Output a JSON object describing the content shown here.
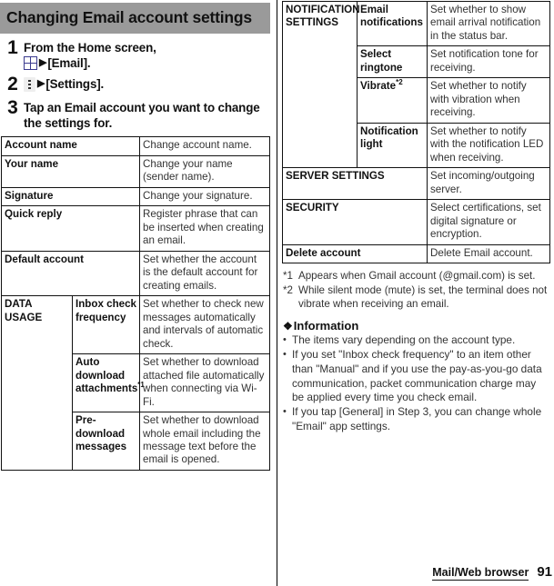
{
  "header": {
    "title": "Changing Email account settings",
    "banner_color": "#9a9a9a"
  },
  "steps": [
    {
      "number": "1",
      "line1": "From the Home screen,",
      "icon": "app-grid-icon",
      "arrow": "▶",
      "target": "[Email]."
    },
    {
      "number": "2",
      "line1": "",
      "icon": "overflow-menu-icon",
      "arrow": "▶",
      "target": "[Settings]."
    },
    {
      "number": "3",
      "line1": "Tap an Email account you want to change the settings for.",
      "icon": "",
      "arrow": "",
      "target": ""
    }
  ],
  "left_table": {
    "rows": [
      {
        "group": "",
        "key": "Account name",
        "desc": "Change account name."
      },
      {
        "group": "",
        "key": "Your name",
        "desc": "Change your name (sender name)."
      },
      {
        "group": "",
        "key": "Signature",
        "desc": "Change your signature."
      },
      {
        "group": "",
        "key": "Quick reply",
        "desc": "Register phrase that can be inserted when creating an email."
      },
      {
        "group": "",
        "key": "Default account",
        "desc": "Set whether the account is the default account for creating emails."
      },
      {
        "group": "DATA USAGE",
        "key": "Inbox check frequency",
        "desc": "Set whether to check new messages automatically and intervals of automatic check."
      },
      {
        "group": "",
        "key": "Auto download attachments",
        "key_sup": "*1",
        "desc": "Set whether to download attached file automatically when connecting via Wi-Fi."
      },
      {
        "group": "",
        "key": "Pre-download messages",
        "desc": "Set whether to download whole email including the message text before the email is opened."
      }
    ],
    "group_label": "DATA USAGE"
  },
  "right_table": {
    "group_label": "NOTIFICATION SETTINGS",
    "rows": [
      {
        "key": "Email notifications",
        "desc": "Set whether to show email arrival notification in the status bar."
      },
      {
        "key": "Select ringtone",
        "desc": "Set notification tone for receiving."
      },
      {
        "key": "Vibrate",
        "key_sup": "*2",
        "desc": "Set whether to notify with vibration when receiving."
      },
      {
        "key": "Notification light",
        "desc": "Set whether to notify with the notification LED when receiving."
      }
    ],
    "spanning_rows": [
      {
        "key": "SERVER SETTINGS",
        "desc": "Set incoming/outgoing server."
      },
      {
        "key": "SECURITY",
        "desc": "Select certifications, set digital signature or encryption."
      },
      {
        "key": "Delete account",
        "desc": "Delete Email account."
      }
    ]
  },
  "footnotes": [
    {
      "mark": "*1",
      "text": "Appears when Gmail account (@gmail.com) is set."
    },
    {
      "mark": "*2",
      "text": "While silent mode (mute) is set, the terminal does not vibrate when receiving an email."
    }
  ],
  "information": {
    "diamond": "❖",
    "heading": "Information",
    "bullet": "•",
    "items": [
      "The items vary depending on the account type.",
      "If you set \"Inbox check frequency\" to an item other than \"Manual\" and if you use the pay-as-you-go data communication, packet communication charge may be applied every time you check email.",
      "If you tap [General] in Step 3, you can change whole \"Email\" app settings."
    ]
  },
  "footer": {
    "section": "Mail/Web browser",
    "page": "91"
  }
}
